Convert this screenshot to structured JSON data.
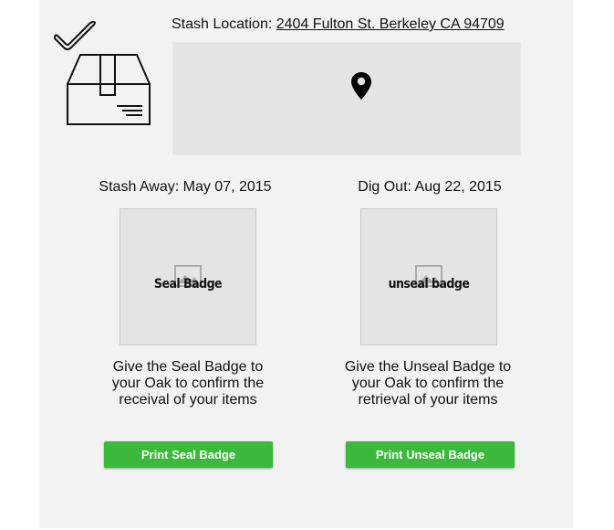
{
  "location": {
    "label": "Stash Location:",
    "address": "2404 Fulton St. Berkeley CA 94709"
  },
  "icons": {
    "status": "box-check-icon",
    "map_pin": "map-pin-icon",
    "image_placeholder": "image-placeholder-icon"
  },
  "seal": {
    "date_label": "Stash Away: May 07, 2015",
    "badge_text": "Seal Badge",
    "description_lines": [
      "Give the Seal Badge to",
      "your Oak to confirm the",
      "receival of your items"
    ],
    "button_label": "Print Seal Badge"
  },
  "unseal": {
    "date_label": "Dig Out: Aug 22, 2015",
    "badge_text": "unseal badge",
    "description_lines": [
      "Give the Unseal Badge to",
      "your Oak to confirm the",
      "retrieval of your items"
    ],
    "button_label": "Print Unseal Badge"
  },
  "colors": {
    "panel_bg": "#f2f2f2",
    "map_bg": "#e4e4e4",
    "button_green": "#3cb83c"
  }
}
